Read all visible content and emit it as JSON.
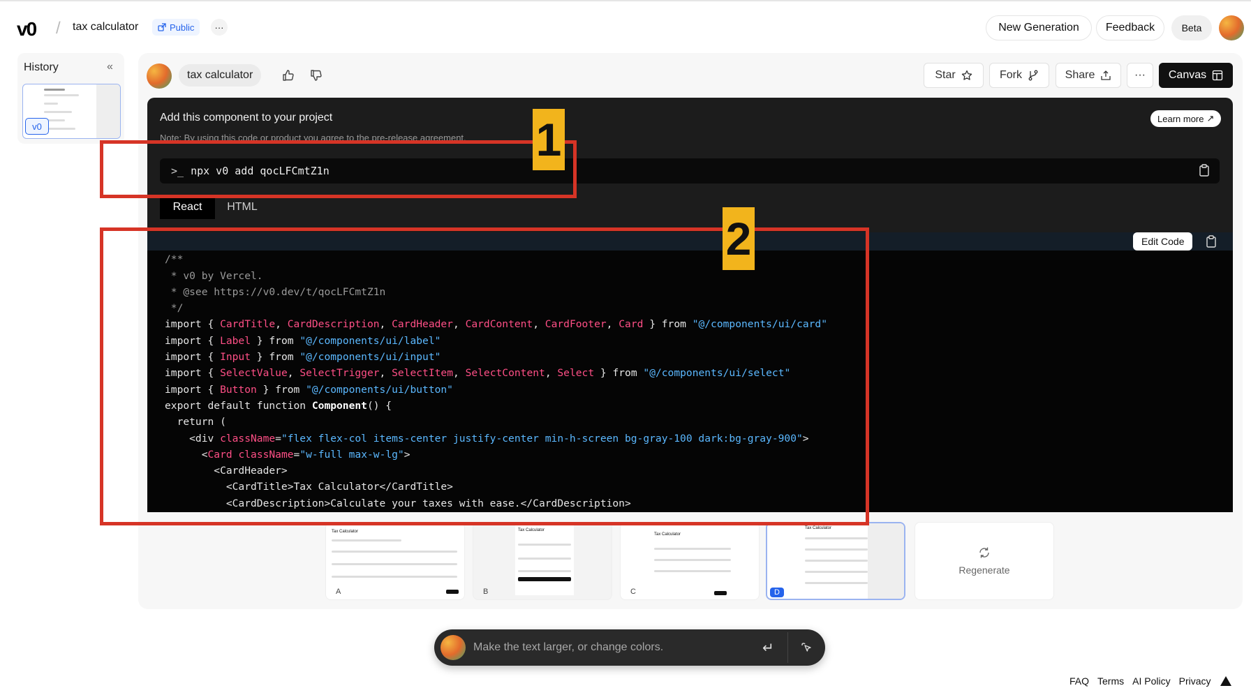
{
  "header": {
    "logo": "v0",
    "project_name": "tax calculator",
    "visibility": "Public",
    "more": "···",
    "new_generation": "New Generation",
    "feedback": "Feedback",
    "beta": "Beta"
  },
  "history": {
    "title": "History",
    "collapse_icon": "double-chevron-left-icon",
    "version_tag": "v0"
  },
  "chat": {
    "title": "tax calculator",
    "thumbs_up_icon": "thumbs-up-icon",
    "thumbs_down_icon": "thumbs-down-icon"
  },
  "toolbar": {
    "star": "Star",
    "fork": "Fork",
    "share": "Share",
    "more": "···",
    "canvas": "Canvas"
  },
  "component": {
    "title": "Add this component to your project",
    "note": "Note: By using this code or product you agree to the pre-release agreement.",
    "learn_more": "Learn more",
    "command": "npx v0 add qocLFCmtZ1n",
    "tabs": [
      "React",
      "HTML"
    ],
    "edit_code": "Edit Code"
  },
  "code_lines": [
    "/**",
    " * v0 by Vercel.",
    " * @see https://v0.dev/t/qocLFCmtZ1n",
    " */",
    "import { CardTitle, CardDescription, CardHeader, CardContent, CardFooter, Card } from \"@/components/ui/card\"",
    "import { Label } from \"@/components/ui/label\"",
    "import { Input } from \"@/components/ui/input\"",
    "import { SelectValue, SelectTrigger, SelectItem, SelectContent, Select } from \"@/components/ui/select\"",
    "import { Button } from \"@/components/ui/button\"",
    "",
    "export default function Component() {",
    "  return (",
    "    <div className=\"flex flex-col items-center justify-center min-h-screen bg-gray-100 dark:bg-gray-900\">",
    "      <Card className=\"w-full max-w-lg\">",
    "        <CardHeader>",
    "          <CardTitle>Tax Calculator</CardTitle>",
    "          <CardDescription>Calculate your taxes with ease.</CardDescription>"
  ],
  "annotations": [
    "1",
    "2"
  ],
  "variants": {
    "labels": [
      "A",
      "B",
      "C",
      "D"
    ],
    "selected": "D",
    "thumb_title": "Tax Calculator",
    "regenerate": "Regenerate"
  },
  "prompt": {
    "placeholder": "Make the text larger, or change colors."
  },
  "footer": {
    "links": [
      "FAQ",
      "Terms",
      "AI Policy",
      "Privacy"
    ]
  },
  "colors": {
    "accent": "#2563eb",
    "annotation_red": "#d63426",
    "annotation_yellow": "#f2b41c",
    "code_pink": "#ff4f86",
    "code_blue": "#5bb8ff"
  }
}
